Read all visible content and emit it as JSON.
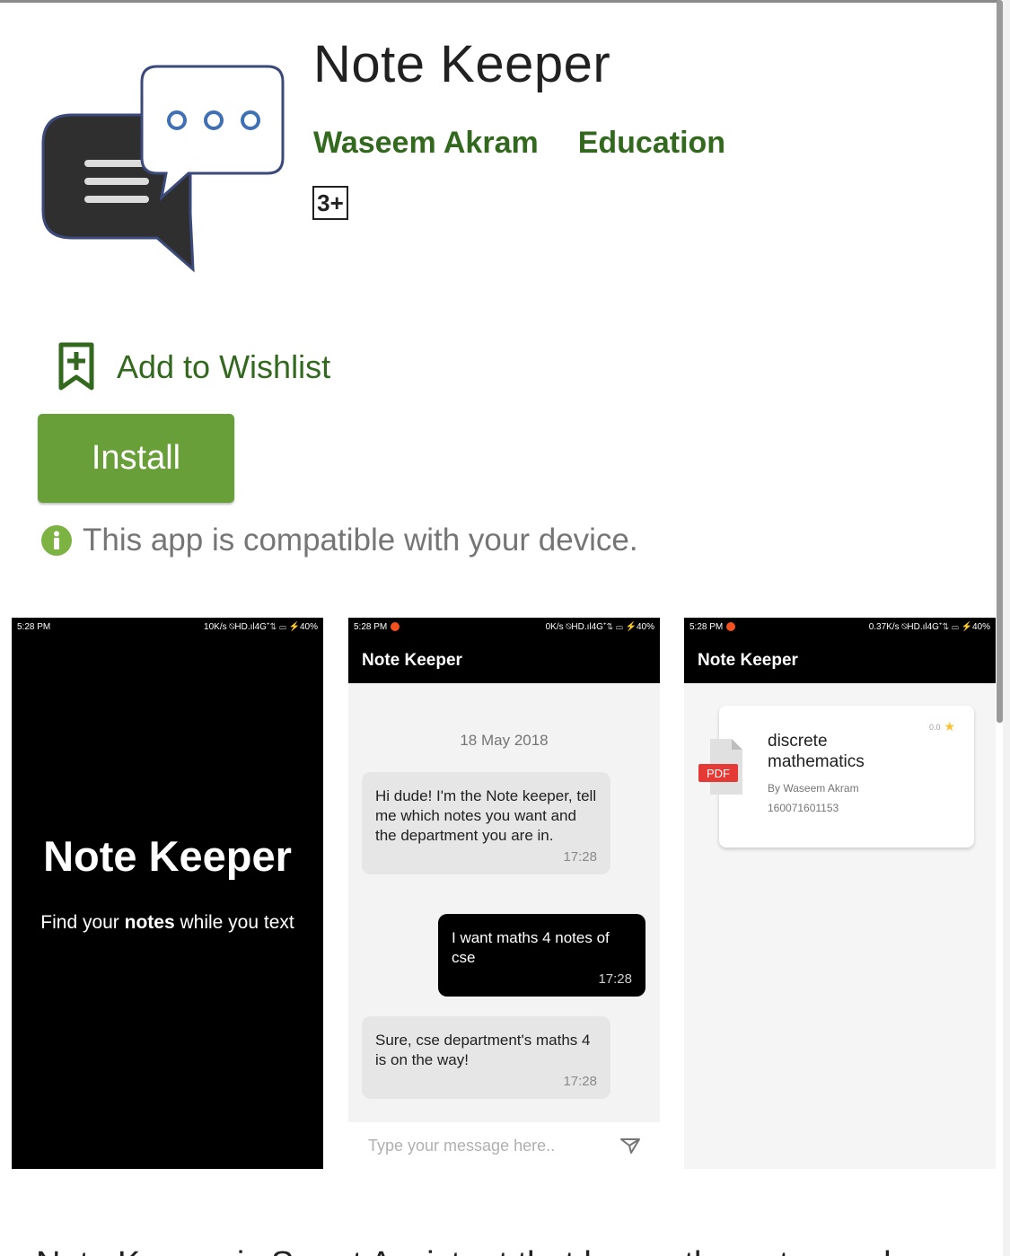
{
  "app": {
    "title": "Note Keeper",
    "developer": "Waseem Akram",
    "category": "Education",
    "content_rating": "3+"
  },
  "actions": {
    "wishlist_label": "Add to Wishlist",
    "install_label": "Install"
  },
  "compatibility": {
    "message": "This app is compatible with your device."
  },
  "screenshots": {
    "splash": {
      "status_time": "5:28 PM",
      "status_right": "10K/s ⍉HD.ıl4G⁺⇅ ▭ ⚡40%",
      "title": "Note Keeper",
      "subtitle_before": "Find your ",
      "subtitle_bold": "notes",
      "subtitle_after": " while you text"
    },
    "chat": {
      "status_time": "5:28 PM",
      "status_right": "0K/s ⍉HD.ıl4G⁺⇅ ▭ ⚡40%",
      "toolbar_title": "Note Keeper",
      "date": "18 May 2018",
      "messages": [
        {
          "text": "Hi dude! I'm the Note keeper, tell me which notes you want and the department you are in.",
          "time": "17:28"
        },
        {
          "text": "I want maths 4 notes of cse",
          "time": "17:28"
        },
        {
          "text": "Sure, cse department's maths 4 is on the way!",
          "time": "17:28"
        }
      ],
      "input_placeholder": "Type your message here.."
    },
    "notes": {
      "status_time": "5:28 PM",
      "status_right": "0.37K/s ⍉HD.ıl4G⁺⇅ ▭ ⚡40%",
      "toolbar_title": "Note Keeper",
      "card": {
        "file_type": "PDF",
        "title": "discrete mathematics",
        "author": "By Waseem Akram",
        "id": "160071601153",
        "rating": "0.0"
      }
    }
  },
  "description_peek": "Note Keeper is Smart Assistant that keeps the notes and",
  "colors": {
    "brand_green": "#33691e",
    "install_green": "#689f38",
    "info_green": "#7cb342"
  }
}
